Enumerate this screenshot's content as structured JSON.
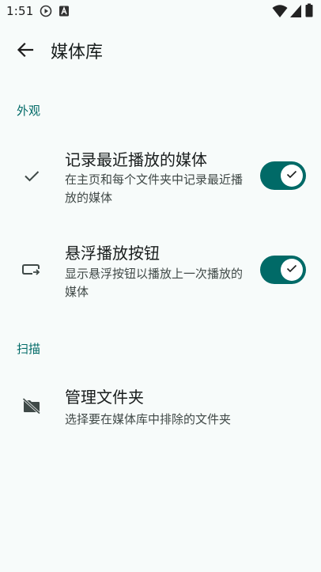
{
  "status_bar": {
    "time": "1:51",
    "icons": [
      "media-play-icon",
      "font-a-icon",
      "wifi-icon",
      "signal-icon",
      "battery-icon"
    ]
  },
  "app_bar": {
    "title": "媒体库",
    "back_icon": "arrow-back-icon"
  },
  "sections": {
    "appearance": {
      "header": "外观",
      "items": [
        {
          "icon": "check-icon",
          "title": "记录最近播放的媒体",
          "summary": "在主页和每个文件夹中记录最近播放的媒体",
          "toggle_on": true
        },
        {
          "icon": "floating-button-icon",
          "title": "悬浮播放按钮",
          "summary": "显示悬浮按钮以播放上一次播放的媒体",
          "toggle_on": true
        }
      ]
    },
    "scan": {
      "header": "扫描",
      "items": [
        {
          "icon": "folder-off-icon",
          "title": "管理文件夹",
          "summary": "选择要在媒体库中排除的文件夹"
        }
      ]
    }
  },
  "colors": {
    "accent": "#006a67",
    "background": "#f7fbfa"
  }
}
